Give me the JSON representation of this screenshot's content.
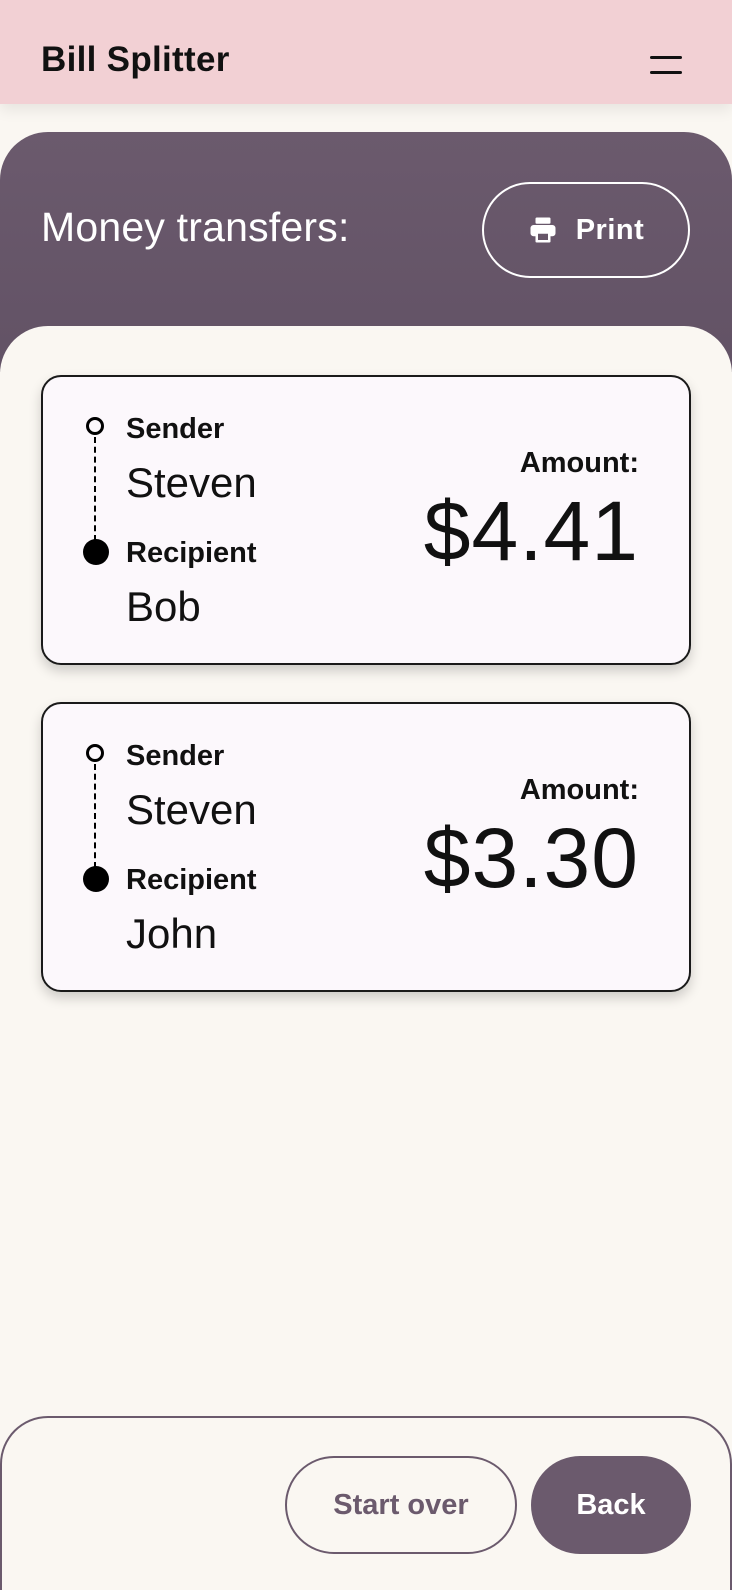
{
  "app_bar": {
    "title": "Bill Splitter",
    "menu_icon": "menu-icon"
  },
  "header": {
    "title": "Money transfers:",
    "print_label": "Print",
    "print_icon": "printer-icon"
  },
  "transfers": [
    {
      "sender_label": "Sender",
      "sender": "Steven",
      "recipient_label": "Recipient",
      "recipient": "Bob",
      "amount_label": "Amount:",
      "amount": "$4.41"
    },
    {
      "sender_label": "Sender",
      "sender": "Steven",
      "recipient_label": "Recipient",
      "recipient": "John",
      "amount_label": "Amount:",
      "amount": "$3.30"
    }
  ],
  "actions": {
    "start_over": "Start over",
    "back": "Back"
  },
  "colors": {
    "app_bar": "#f2d0d4",
    "accent": "#6b5a6d",
    "background": "#faf7f2",
    "card": "#fcf8fc"
  }
}
